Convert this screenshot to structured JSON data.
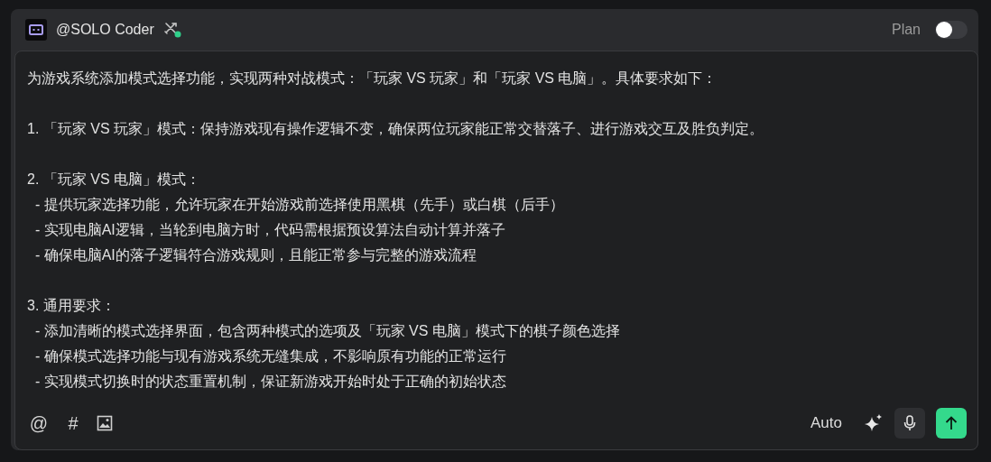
{
  "header": {
    "agent": "@SOLO Coder",
    "agent_online": true,
    "plan_label": "Plan",
    "plan_on": false
  },
  "prompt": {
    "paragraphs": [
      [
        "为游戏系统添加模式选择功能，实现两种对战模式：「玩家 VS 玩家」和「玩家 VS 电脑」。具体要求如下："
      ],
      [
        "1. 「玩家 VS 玩家」模式：保持游戏现有操作逻辑不变，确保两位玩家能正常交替落子、进行游戏交互及胜负判定。"
      ],
      [
        "2. 「玩家 VS 电脑」模式：",
        "  - 提供玩家选择功能，允许玩家在开始游戏前选择使用黑棋（先手）或白棋（后手）",
        "  - 实现电脑AI逻辑，当轮到电脑方时，代码需根据预设算法自动计算并落子",
        "  - 确保电脑AI的落子逻辑符合游戏规则，且能正常参与完整的游戏流程"
      ],
      [
        "3. 通用要求：",
        "  - 添加清晰的模式选择界面，包含两种模式的选项及「玩家 VS 电脑」模式下的棋子颜色选择",
        "  - 确保模式选择功能与现有游戏系统无缝集成，不影响原有功能的正常运行",
        "  - 实现模式切换时的状态重置机制，保证新游戏开始时处于正确的初始状态"
      ]
    ]
  },
  "toolbar": {
    "mention": "@",
    "topic": "#",
    "mode": "Auto"
  }
}
